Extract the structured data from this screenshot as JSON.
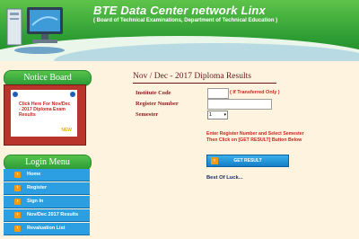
{
  "header": {
    "title": "BTE Data Center network Linx",
    "subtitle": "( Board of Technical Examinations, Department of Technical Education )"
  },
  "sidebar": {
    "notice_title": "Notice Board",
    "notice_text": "Click Here For Nov/Dec - 2017 Diploma Exam Results",
    "notice_badge": "NEW",
    "login_title": "Login Menu",
    "menu_items": [
      {
        "label": "Home"
      },
      {
        "label": "Register"
      },
      {
        "label": "Sign In"
      },
      {
        "label": "Nov/Dec 2017 Results"
      },
      {
        "label": "Revaluation List"
      }
    ]
  },
  "main": {
    "title": "Nov / Dec - 2017 Diploma Results",
    "institute_label": "Institute Code",
    "institute_value": "",
    "institute_note": "( If Transferred Only )",
    "register_label": "Register Number",
    "register_value": "",
    "semester_label": "Semester",
    "semester_value": "1",
    "instruction_1": "Enter Register Number and Select Semester",
    "instruction_2": "Then Click on [GET RESULT] Button Below",
    "button_label": "GET RESULT",
    "footer_text": "Best Of Luck..."
  },
  "colors": {
    "header_green": "#2e9e34",
    "accent_red": "#d0231c",
    "menu_blue": "#2b9fe1",
    "arrow_orange": "#f39a16"
  }
}
